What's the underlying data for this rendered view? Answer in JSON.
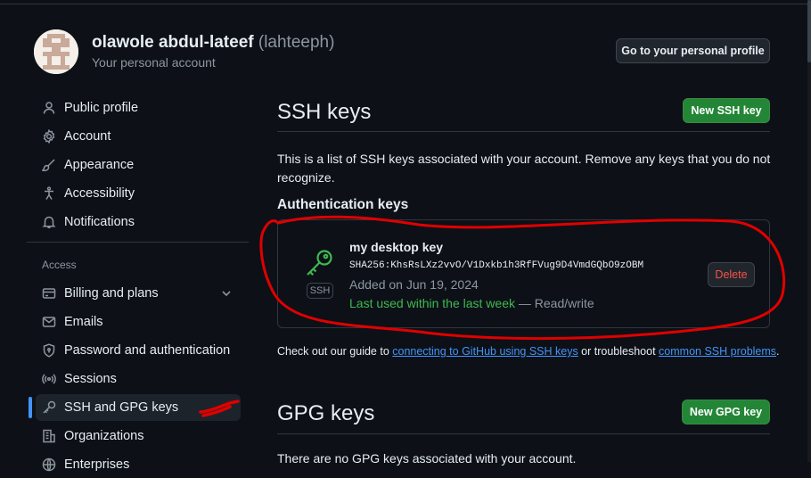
{
  "header": {
    "display_name": "olawole abdul-lateef",
    "handle": "(lahteeph)",
    "subtitle": "Your personal account",
    "profile_button": "Go to your personal profile"
  },
  "sidebar": {
    "items": [
      {
        "label": "Public profile",
        "icon": "person-icon"
      },
      {
        "label": "Account",
        "icon": "gear-icon"
      },
      {
        "label": "Appearance",
        "icon": "paintbrush-icon"
      },
      {
        "label": "Accessibility",
        "icon": "accessibility-icon"
      },
      {
        "label": "Notifications",
        "icon": "bell-icon"
      }
    ],
    "access_label": "Access",
    "access_items": [
      {
        "label": "Billing and plans",
        "icon": "credit-card-icon"
      },
      {
        "label": "Emails",
        "icon": "mail-icon"
      },
      {
        "label": "Password and authentication",
        "icon": "shield-lock-icon"
      },
      {
        "label": "Sessions",
        "icon": "broadcast-icon"
      },
      {
        "label": "SSH and GPG keys",
        "icon": "key-icon",
        "active": true
      },
      {
        "label": "Organizations",
        "icon": "organization-icon"
      },
      {
        "label": "Enterprises",
        "icon": "globe-icon"
      }
    ]
  },
  "ssh": {
    "title": "SSH keys",
    "new_button": "New SSH key",
    "description": "This is a list of SSH keys associated with your account. Remove any keys that you do not recognize.",
    "auth_heading": "Authentication keys",
    "key": {
      "badge": "SSH",
      "title": "my desktop key",
      "fingerprint": "SHA256:KhsRsLXz2vvO/V1Dxkb1h3RfFVug9D4VmdGQbO9zOBM",
      "added": "Added on Jun 19, 2024",
      "last_used": "Last used within the last week",
      "access": " — Read/write",
      "delete_button": "Delete"
    },
    "guide": {
      "prefix": "Check out our guide to ",
      "link1": "connecting to GitHub using SSH keys",
      "middle": " or troubleshoot ",
      "link2": "common SSH problems",
      "suffix": "."
    }
  },
  "gpg": {
    "title": "GPG keys",
    "new_button": "New GPG key",
    "description": "There are no GPG keys associated with your account."
  },
  "colors": {
    "background": "#0d1117",
    "accent_blue": "#4493f8",
    "green_button": "#238636",
    "danger": "#f85149",
    "annotation_red": "#e00000"
  }
}
